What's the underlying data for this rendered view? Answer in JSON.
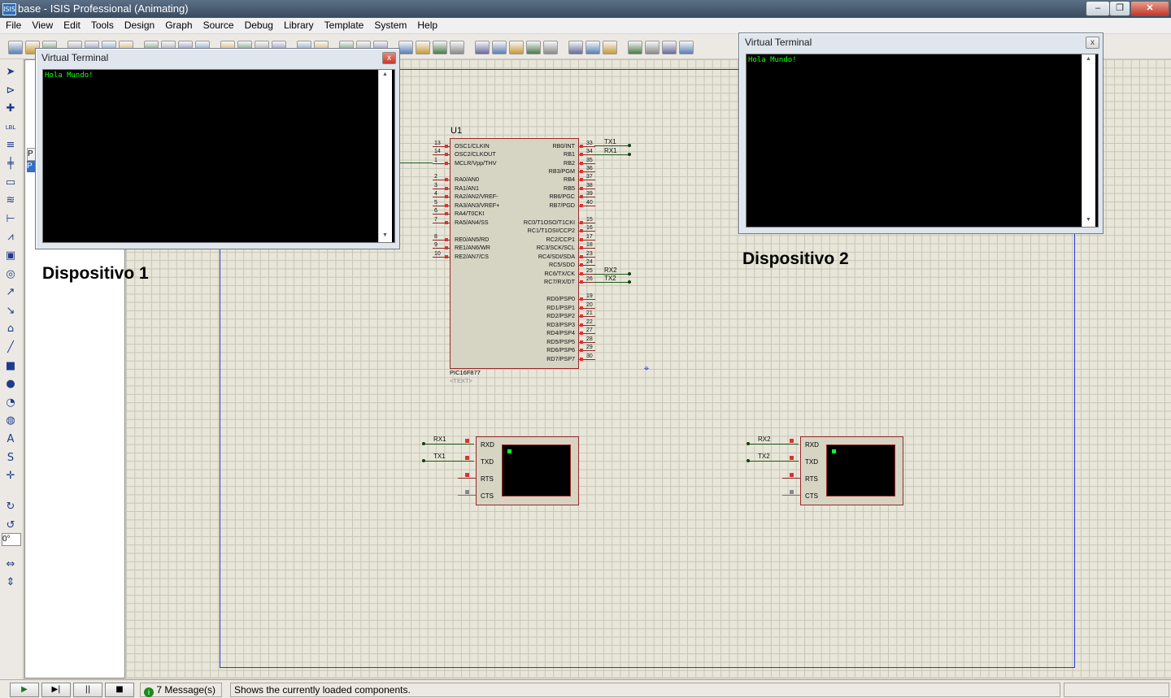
{
  "window": {
    "title": "base - ISIS Professional (Animating)",
    "app_icon_text": "ISIS",
    "controls": [
      "minimize",
      "maximize",
      "close"
    ]
  },
  "menu": [
    "File",
    "View",
    "Edit",
    "Tools",
    "Design",
    "Graph",
    "Source",
    "Debug",
    "Library",
    "Template",
    "System",
    "Help"
  ],
  "toolbar_icons": [
    "new-icon",
    "open-icon",
    "save-icon",
    "import-icon",
    "export-icon",
    "print-icon",
    "set-area-icon",
    "redraw-icon",
    "grid-icon",
    "origin-icon",
    "pan-icon",
    "zoom-in-icon",
    "zoom-out-icon",
    "zoom-all-icon",
    "zoom-area-icon",
    "undo-icon",
    "redo-icon",
    "cut-icon",
    "copy-icon",
    "paste-icon",
    "block-copy-icon",
    "block-move-icon",
    "block-rotate-icon",
    "block-delete-icon",
    "pick-device-icon",
    "make-device-icon",
    "package-icon",
    "decompose-icon",
    "wire-autoroute-icon",
    "search-icon",
    "property-icon",
    "netlist-icon",
    "bom-icon",
    "erc-icon",
    "ares-icon",
    "export-netlist-icon"
  ],
  "left_tools": [
    "selection-mode-icon",
    "component-mode-icon",
    "junction-dot-icon",
    "wire-label-icon",
    "text-script-icon",
    "bus-icon",
    "subcircuit-icon",
    "terminals-icon",
    "device-pins-icon",
    "graph-mode-icon",
    "tape-recorder-icon",
    "generator-icon",
    "voltage-probe-icon",
    "current-probe-icon",
    "virtual-instruments-icon",
    "line-icon",
    "box-icon",
    "circle-icon",
    "arc-icon",
    "path-icon",
    "text-icon",
    "symbol-icon",
    "marker-icon",
    "rotate-cw-icon",
    "rotate-ccw-icon",
    "flip-h-icon",
    "flip-v-icon"
  ],
  "rotation_value": "0°",
  "device_panel": {
    "tab_label": "P",
    "selected": "P"
  },
  "schematic": {
    "chip": {
      "ref": "U1",
      "part": "PIC16F877",
      "text_placeholder": "<TEXT>",
      "left_pins": [
        {
          "num": "13",
          "name": "OSC1/CLKIN"
        },
        {
          "num": "14",
          "name": "OSC2/CLKOUT"
        },
        {
          "num": "1",
          "name": "MCLR/Vpp/THV"
        },
        {
          "num": "2",
          "name": "RA0/AN0"
        },
        {
          "num": "3",
          "name": "RA1/AN1"
        },
        {
          "num": "4",
          "name": "RA2/AN2/VREF-"
        },
        {
          "num": "5",
          "name": "RA3/AN3/VREF+"
        },
        {
          "num": "6",
          "name": "RA4/T0CKI"
        },
        {
          "num": "7",
          "name": "RA5/AN4/SS"
        },
        {
          "num": "8",
          "name": "RE0/AN5/RD"
        },
        {
          "num": "9",
          "name": "RE1/AN6/WR"
        },
        {
          "num": "10",
          "name": "RE2/AN7/CS"
        }
      ],
      "right_pins": [
        {
          "num": "33",
          "name": "RB0/INT"
        },
        {
          "num": "34",
          "name": "RB1"
        },
        {
          "num": "35",
          "name": "RB2"
        },
        {
          "num": "36",
          "name": "RB3/PGM"
        },
        {
          "num": "37",
          "name": "RB4"
        },
        {
          "num": "38",
          "name": "RB5"
        },
        {
          "num": "39",
          "name": "RB6/PGC"
        },
        {
          "num": "40",
          "name": "RB7/PGD"
        },
        {
          "num": "15",
          "name": "RC0/T1OSO/T1CKI"
        },
        {
          "num": "16",
          "name": "RC1/T1OSI/CCP2"
        },
        {
          "num": "17",
          "name": "RC2/CCP1"
        },
        {
          "num": "18",
          "name": "RC3/SCK/SCL"
        },
        {
          "num": "23",
          "name": "RC4/SDI/SDA"
        },
        {
          "num": "24",
          "name": "RC5/SDO"
        },
        {
          "num": "25",
          "name": "RC6/TX/CK"
        },
        {
          "num": "26",
          "name": "RC7/RX/DT"
        },
        {
          "num": "19",
          "name": "RD0/PSP0"
        },
        {
          "num": "20",
          "name": "RD1/PSP1"
        },
        {
          "num": "21",
          "name": "RD2/PSP2"
        },
        {
          "num": "22",
          "name": "RD3/PSP3"
        },
        {
          "num": "27",
          "name": "RD4/PSP4"
        },
        {
          "num": "28",
          "name": "RD5/PSP5"
        },
        {
          "num": "29",
          "name": "RD6/PSP6"
        },
        {
          "num": "30",
          "name": "RD7/PSP7"
        }
      ],
      "net_labels": [
        "TX1",
        "RX1",
        "RX2",
        "TX2"
      ]
    },
    "terminal1": {
      "pins": [
        "RXD",
        "TXD",
        "RTS",
        "CTS"
      ],
      "nets": [
        "RX1",
        "TX1"
      ]
    },
    "terminal2": {
      "pins": [
        "RXD",
        "TXD",
        "RTS",
        "CTS"
      ],
      "nets": [
        "RX2",
        "TX2"
      ]
    }
  },
  "vt_window_1": {
    "title": "Virtual Terminal",
    "output": "Hola Mundo!",
    "close": "x"
  },
  "vt_window_2": {
    "title": "Virtual Terminal",
    "output": "Hola Mundo!",
    "close": "x"
  },
  "device_label_1": "Dispositivo 1",
  "device_label_2": "Dispositivo 2",
  "status": {
    "play": "▶",
    "step": "▶|",
    "pause": "||",
    "stop": "■",
    "messages": "7 Message(s)",
    "hint": "Shows the currently loaded components."
  },
  "colors": {
    "sheet_border": "#2a3ad0",
    "component_outline": "#9a2a2a",
    "terminal_text": "#1aff1a",
    "wire": "#1c5a1c"
  }
}
